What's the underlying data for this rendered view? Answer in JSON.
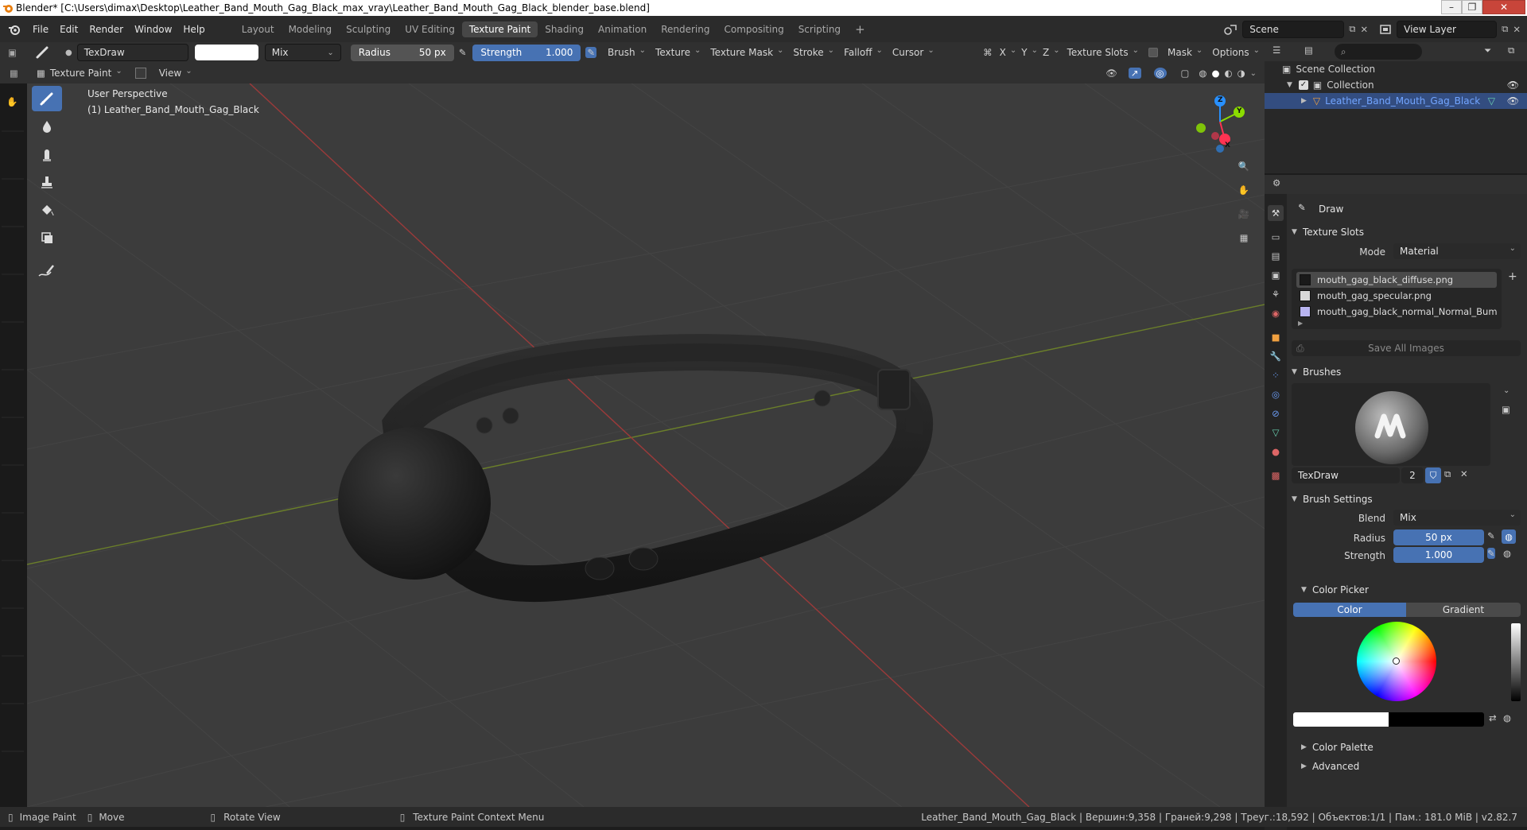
{
  "window": {
    "title": "Blender* [C:\\Users\\dimax\\Desktop\\Leather_Band_Mouth_Gag_Black_max_vray\\Leather_Band_Mouth_Gag_Black_blender_base.blend]"
  },
  "menu": [
    "File",
    "Edit",
    "Render",
    "Window",
    "Help"
  ],
  "workspaces": [
    {
      "label": "Layout",
      "active": false
    },
    {
      "label": "Modeling",
      "active": false
    },
    {
      "label": "Sculpting",
      "active": false
    },
    {
      "label": "UV Editing",
      "active": false
    },
    {
      "label": "Texture Paint",
      "active": true
    },
    {
      "label": "Shading",
      "active": false
    },
    {
      "label": "Animation",
      "active": false
    },
    {
      "label": "Rendering",
      "active": false
    },
    {
      "label": "Compositing",
      "active": false
    },
    {
      "label": "Scripting",
      "active": false
    }
  ],
  "add_workspace": "+",
  "scene": {
    "name": "Scene"
  },
  "view_layer": {
    "name": "View Layer"
  },
  "tool_header": {
    "brush_name": "TexDraw",
    "blend": "Mix",
    "radius_label": "Radius",
    "radius_value": "50 px",
    "strength_label": "Strength",
    "strength_value": "1.000",
    "menus": [
      "Brush",
      "Texture",
      "Texture Mask",
      "Stroke",
      "Falloff",
      "Cursor"
    ],
    "axes": [
      "X",
      "Y",
      "Z"
    ],
    "texture_slots": "Texture Slots",
    "mask": "Mask",
    "options": "Options"
  },
  "viewport_header": {
    "mode": "Texture Paint",
    "view": "View"
  },
  "viewport": {
    "perspective": "User Perspective",
    "object_label": "(1) Leather_Band_Mouth_Gag_Black",
    "gizmo": {
      "x": "X",
      "y": "Y",
      "z": "Z"
    }
  },
  "outliner": {
    "scene_collection": "Scene Collection",
    "collection": "Collection",
    "object": "Leather_Band_Mouth_Gag_Black"
  },
  "properties": {
    "tool_name": "Draw",
    "texture_slots": {
      "title": "Texture Slots",
      "mode_label": "Mode",
      "mode_value": "Material",
      "slots": [
        {
          "name": "mouth_gag_black_diffuse.png",
          "color": "#1a1a1a",
          "selected": true
        },
        {
          "name": "mouth_gag_specular.png",
          "color": "#d8d8d8",
          "selected": false
        },
        {
          "name": "mouth_gag_black_normal_Normal_Bump.t...",
          "color": "#b8b4f0",
          "selected": false
        }
      ],
      "save_all": "Save All Images"
    },
    "brushes": {
      "title": "Brushes",
      "brush_name": "TexDraw",
      "users": "2"
    },
    "brush_settings": {
      "title": "Brush Settings",
      "blend_label": "Blend",
      "blend_value": "Mix",
      "radius_label": "Radius",
      "radius_value": "50 px",
      "strength_label": "Strength",
      "strength_value": "1.000"
    },
    "color_picker": {
      "title": "Color Picker",
      "tab_color": "Color",
      "tab_gradient": "Gradient"
    },
    "color_palette": "Color Palette",
    "advanced": "Advanced"
  },
  "status_bar": {
    "left": [
      "Image Paint",
      "Move",
      "Rotate View",
      "Texture Paint Context Menu"
    ],
    "stats": "Leather_Band_Mouth_Gag_Black | Вершин:9,358 | Граней:9,298 | Треуг.:18,592 | Объектов:1/1 | Пам.: 181.0 MiB | v2.82.7"
  },
  "colors": {
    "accent": "#4772b3",
    "selected_text": "#72a5ff",
    "axis_x": "#ff3352",
    "axis_y": "#8bdc00",
    "axis_z": "#2890ff"
  }
}
